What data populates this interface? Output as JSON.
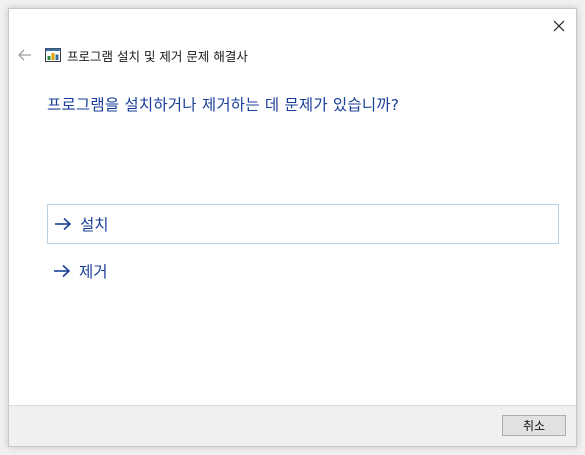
{
  "window": {
    "title": "프로그램 설치 및 제거 문제 해결사"
  },
  "main": {
    "question": "프로그램을 설치하거나 제거하는 데 문제가 있습니까?",
    "options": [
      {
        "label": "설치",
        "icon": "arrow-right-icon"
      },
      {
        "label": "제거",
        "icon": "arrow-right-icon"
      }
    ]
  },
  "footer": {
    "cancel_label": "취소"
  },
  "colors": {
    "accent": "#1a3f99",
    "selected_border": "#b8d3e8",
    "footer_bg": "#f0f0f0"
  }
}
